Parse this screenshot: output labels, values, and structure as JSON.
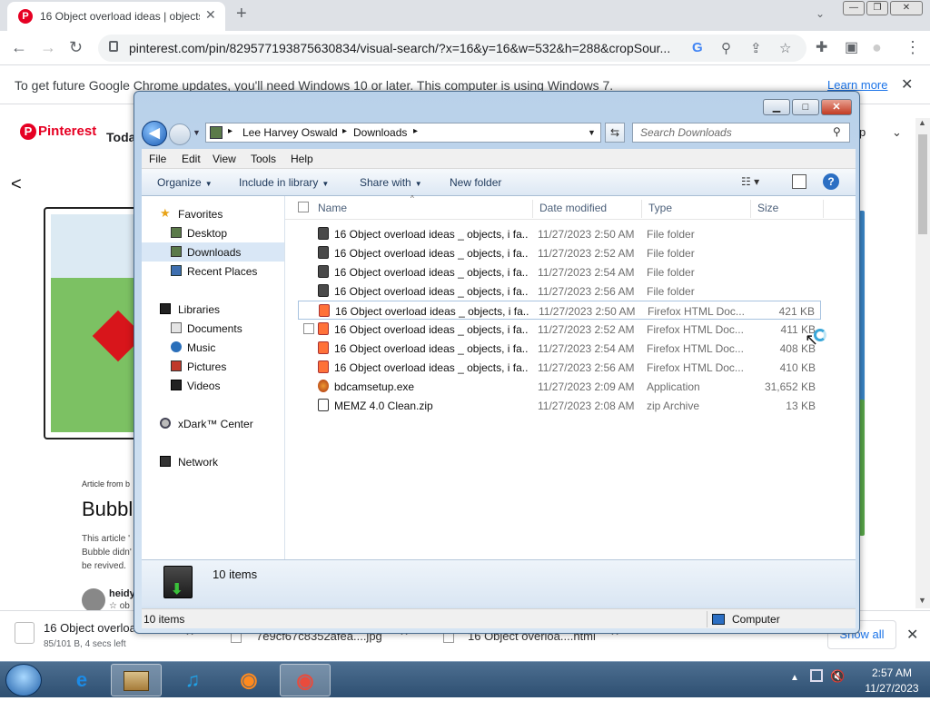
{
  "browser": {
    "tab": {
      "favicon": "P",
      "title": "16 Object overload ideas | objects"
    },
    "new_tab": "+",
    "window_controls": {
      "minimize": "—",
      "restore": "❐",
      "close": "✕"
    },
    "nav": {
      "back": "←",
      "forward": "→",
      "reload": "↻"
    },
    "url": "pinterest.com/pin/829577193875630834/visual-search/?x=16&y=16&w=532&h=288&cropSour...",
    "omnibox_icons": {
      "google": "G",
      "zoom": "⚲",
      "share": "⇪",
      "bookmark": "☆"
    },
    "toolbar_icons": {
      "extensions": "✚",
      "sidepanel": "▣",
      "profile": "●",
      "menu": "⋮"
    },
    "infobar": {
      "text": "To get future Google Chrome updates, you'll need Windows 10 or later. This computer is using Windows 7.",
      "link": "Learn more",
      "close": "✕"
    }
  },
  "pinterest": {
    "logo": "Pinterest",
    "logo_icon": "P",
    "today": "Today",
    "back": "<",
    "article_from": "Article from b",
    "title": "Bubbl",
    "body": "This article ' Bubble didn' be revived.",
    "author": "heidy",
    "author_sub": "☆ ob",
    "right_btn": "p",
    "right_chevron": "⌄"
  },
  "downloads_bar": {
    "items": [
      {
        "name": "16 Object overload",
        "status": "85/101 B, 4 secs left"
      },
      {
        "name": "7e9cf67c8352afea....jpg"
      },
      {
        "name": "16 Object overloa....html"
      }
    ],
    "show_all": "Show all",
    "close": "✕",
    "item_close": "✕"
  },
  "taskbar": {
    "time": "2:57 AM",
    "date": "11/27/2023",
    "apps": {
      "ie": "e",
      "music": "♫",
      "firefox": "◉",
      "chrome": "◉"
    },
    "tray_arrow": "▲",
    "tray_volume": "🔇"
  },
  "explorer": {
    "caption": {
      "minimize": "▁",
      "maximize": "□",
      "close": "✕"
    },
    "back": "◀",
    "address": {
      "crumbs": [
        "Lee Harvey Oswald",
        "Downloads"
      ],
      "sep": "▸",
      "dropdown": "▼"
    },
    "refresh": "⇆",
    "search": {
      "placeholder": "Search Downloads",
      "icon": "⚲"
    },
    "menu": [
      "File",
      "Edit",
      "View",
      "Tools",
      "Help"
    ],
    "commands": {
      "organize": "Organize",
      "include_in_library": "Include in library",
      "share_with": "Share with",
      "new_folder": "New folder"
    },
    "caret": "▼",
    "view_icon": "☷ ▾",
    "help": "?",
    "nav": {
      "favorites": "Favorites",
      "desktop": "Desktop",
      "downloads": "Downloads",
      "recent_places": "Recent Places",
      "libraries": "Libraries",
      "documents": "Documents",
      "music": "Music",
      "pictures": "Pictures",
      "videos": "Videos",
      "xdark": "xDark™ Center",
      "network": "Network"
    },
    "columns": {
      "name": "Name",
      "date": "Date modified",
      "type": "Type",
      "size": "Size",
      "sort": "^"
    },
    "files": [
      {
        "name": "16 Object overload ideas _ objects, i fa...",
        "date": "11/27/2023 2:50 AM",
        "type": "File folder",
        "size": "",
        "kind": "folder"
      },
      {
        "name": "16 Object overload ideas _ objects, i fa...",
        "date": "11/27/2023 2:52 AM",
        "type": "File folder",
        "size": "",
        "kind": "folder"
      },
      {
        "name": "16 Object overload ideas _ objects, i fa...",
        "date": "11/27/2023 2:54 AM",
        "type": "File folder",
        "size": "",
        "kind": "folder"
      },
      {
        "name": "16 Object overload ideas _ objects, i fa...",
        "date": "11/27/2023 2:56 AM",
        "type": "File folder",
        "size": "",
        "kind": "folder"
      },
      {
        "name": "16 Object overload ideas _ objects, i fa...",
        "date": "11/27/2023 2:50 AM",
        "type": "Firefox HTML Doc...",
        "size": "421 KB",
        "kind": "html"
      },
      {
        "name": "16 Object overload ideas _ objects, i fa...",
        "date": "11/27/2023 2:52 AM",
        "type": "Firefox HTML Doc...",
        "size": "411 KB",
        "kind": "html"
      },
      {
        "name": "16 Object overload ideas _ objects, i fa...",
        "date": "11/27/2023 2:54 AM",
        "type": "Firefox HTML Doc...",
        "size": "408 KB",
        "kind": "html"
      },
      {
        "name": "16 Object overload ideas _ objects, i fa...",
        "date": "11/27/2023 2:56 AM",
        "type": "Firefox HTML Doc...",
        "size": "410 KB",
        "kind": "html"
      },
      {
        "name": "bdcamsetup.exe",
        "date": "11/27/2023 2:09 AM",
        "type": "Application",
        "size": "31,652 KB",
        "kind": "exe"
      },
      {
        "name": "MEMZ 4.0 Clean.zip",
        "date": "11/27/2023 2:08 AM",
        "type": "zip Archive",
        "size": "13 KB",
        "kind": "zip"
      }
    ],
    "details_count": "10 items",
    "details_arrow": "⬇",
    "status_count": "10 items",
    "status_location": "Computer"
  },
  "cursor": "↖",
  "colors": {
    "pinterest_red": "#e60023",
    "chrome_link": "#1a73e8",
    "selection": "#d9e7f6",
    "taskbar": "#2e4f71"
  }
}
